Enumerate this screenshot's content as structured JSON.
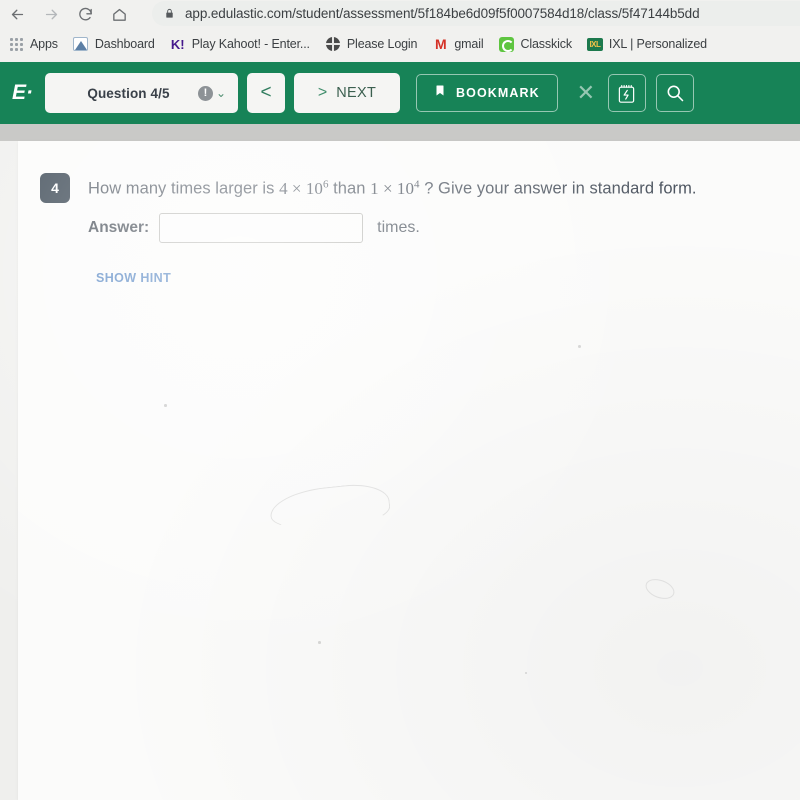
{
  "browser": {
    "nav": {
      "back": "back-arrow",
      "forward": "forward-arrow",
      "reload": "reload",
      "home": "home"
    },
    "url": "app.edulastic.com/student/assessment/5f184be6d09f5f0007584d18/class/5f47144b5dd",
    "lock": "lock-icon",
    "bookmarks": [
      {
        "label": "Apps",
        "icon": "apps-grid-icon"
      },
      {
        "label": "Dashboard",
        "icon": "dashboard-icon"
      },
      {
        "label": "Play Kahoot! - Enter...",
        "icon": "kahoot-icon"
      },
      {
        "label": "Please Login",
        "icon": "globe-icon"
      },
      {
        "label": "gmail",
        "icon": "gmail-icon"
      },
      {
        "label": "Classkick",
        "icon": "classkick-icon"
      },
      {
        "label": "IXL | Personalized",
        "icon": "ixl-icon"
      }
    ]
  },
  "appbar": {
    "brand": "E·",
    "question_pill": "Question 4/5",
    "info_glyph": "!",
    "chevron": "⌄",
    "prev_label": "<",
    "next_arrow": ">",
    "next_label": "NEXT",
    "bookmark_label": "BOOKMARK",
    "close_glyph": "✕",
    "calculator_icon": "calculator-icon",
    "search_icon": "search-icon",
    "bg_color": "#148456"
  },
  "question": {
    "number": "4",
    "text_part1": "How many times larger is ",
    "expr1_base": "4 × 10",
    "expr1_exp": "6",
    "text_part2": " than ",
    "expr2_base": "1 × 10",
    "expr2_exp": "4",
    "text_part3": " ?  Give your answer in standard form.",
    "answer_label": "Answer:",
    "answer_value": "",
    "answer_placeholder": "",
    "answer_suffix": "times.",
    "show_hint": "SHOW HINT"
  }
}
